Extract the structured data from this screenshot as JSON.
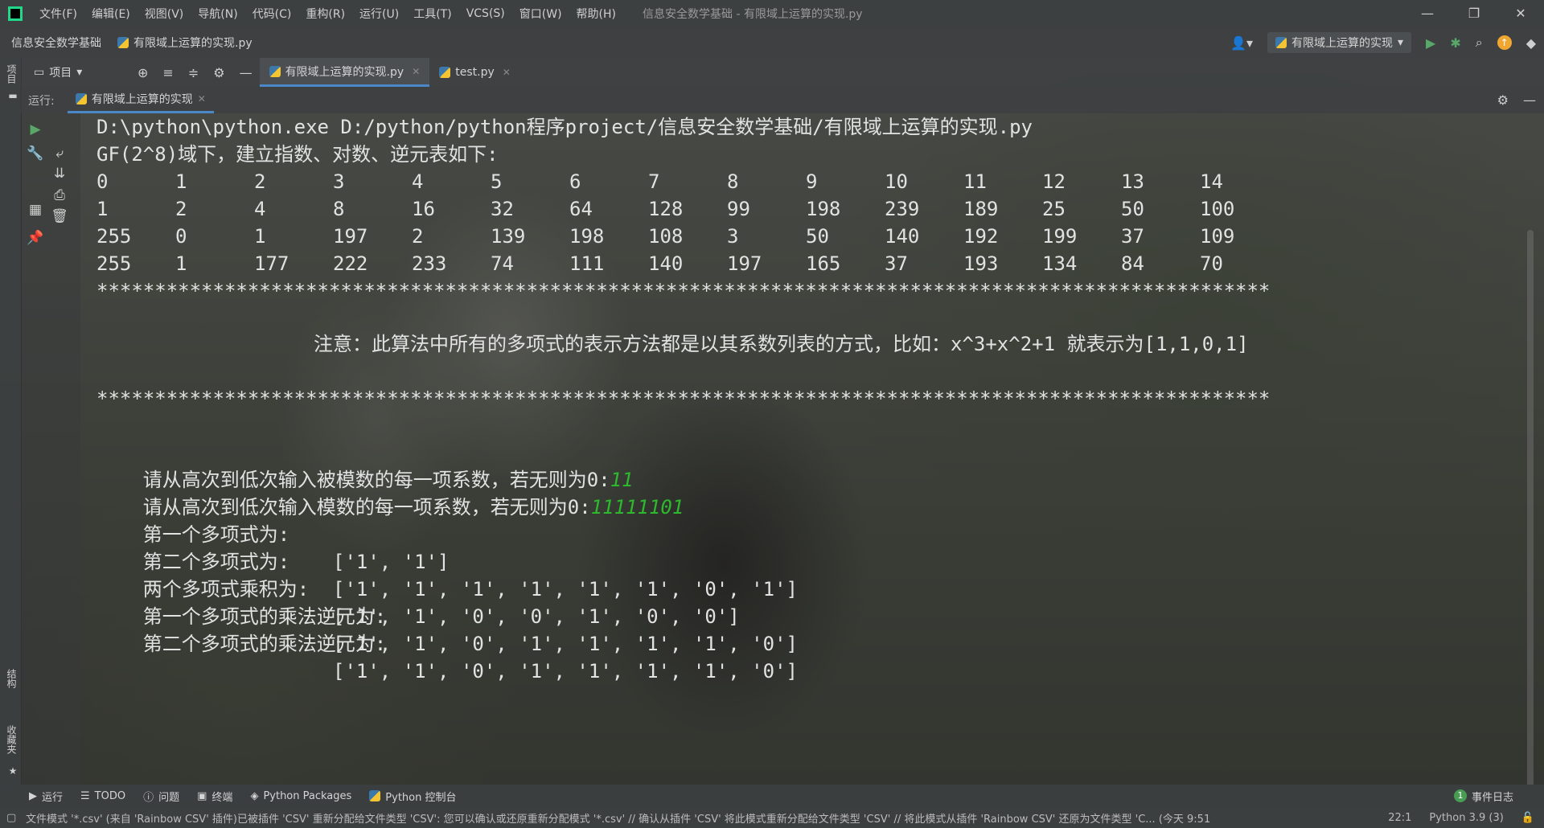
{
  "menubar": {
    "items": [
      "文件(F)",
      "编辑(E)",
      "视图(V)",
      "导航(N)",
      "代码(C)",
      "重构(R)",
      "运行(U)",
      "工具(T)",
      "VCS(S)",
      "窗口(W)",
      "帮助(H)"
    ],
    "window_title": "信息安全数学基础 - 有限域上运算的实现.py",
    "controls": [
      "—",
      "❐",
      "✕"
    ]
  },
  "navbar": {
    "project": "信息安全数学基础",
    "file": "有限域上运算的实现.py",
    "run_config": "有限域上运算的实现"
  },
  "tabbar": {
    "project_label": "项目",
    "tabs": [
      {
        "label": "有限域上运算的实现.py",
        "active": true
      },
      {
        "label": "test.py",
        "active": false
      }
    ]
  },
  "leftstrip": {
    "project_tab": "项目",
    "structure_tab": "结构",
    "favorites_tab": "收藏夹"
  },
  "runbar": {
    "label": "运行:",
    "tab": "有限域上运算的实现"
  },
  "console": {
    "command": "D:\\python\\python.exe D:/python/python程序project/信息安全数学基础/有限域上运算的实现.py",
    "heading": "GF(2^8)域下，建立指数、对数、逆元表如下:",
    "table": [
      [
        "0",
        "1",
        "2",
        "3",
        "4",
        "5",
        "6",
        "7",
        "8",
        "9",
        "10",
        "11",
        "12",
        "13",
        "14"
      ],
      [
        "1",
        "2",
        "4",
        "8",
        "16",
        "32",
        "64",
        "128",
        "99",
        "198",
        "239",
        "189",
        "25",
        "50",
        "100"
      ],
      [
        "255",
        "0",
        "1",
        "197",
        "2",
        "139",
        "198",
        "108",
        "3",
        "50",
        "140",
        "192",
        "199",
        "37",
        "109"
      ],
      [
        "255",
        "1",
        "177",
        "222",
        "233",
        "74",
        "111",
        "140",
        "197",
        "165",
        "37",
        "193",
        "134",
        "84",
        "70"
      ]
    ],
    "separator": "*****************************************************************************************************",
    "note": "注意：此算法中所有的多项式的表示方法都是以其系数列表的方式，比如：x^3+x^2+1 就表示为[1,1,0,1]",
    "prompt1": "请从高次到低次输入被模数的每一项系数，若无则为0:",
    "input1": "11",
    "prompt2": "请从高次到低次输入模数的每一项系数，若无则为0:",
    "input2": "11111101",
    "results": [
      {
        "label": "第一个多项式为:",
        "value": "['1', '1']"
      },
      {
        "label": "第二个多项式为:",
        "value": "['1', '1', '1', '1', '1', '1', '0', '1']"
      },
      {
        "label": "两个多项式乘积为:",
        "value": "['1', '1', '0', '0', '1', '0', '0']"
      },
      {
        "label": "第一个多项式的乘法逆元为:",
        "value": "['1', '1', '0', '1', '1', '1', '1', '0']"
      },
      {
        "label": "第二个多项式的乘法逆元为:",
        "value": "['1', '1', '0', '1', '1', '1', '1', '0']"
      }
    ]
  },
  "bottombar": {
    "tabs": [
      "运行",
      "TODO",
      "问题",
      "终端",
      "Python Packages",
      "Python 控制台"
    ],
    "event_log": "事件日志",
    "event_count": "1"
  },
  "statusbar": {
    "message": "文件模式 '*.csv' (来自 'Rainbow CSV' 插件)已被插件 'CSV' 重新分配给文件类型 'CSV': 您可以确认或还原重新分配模式 '*.csv' // 确认从插件 'CSV' 将此模式重新分配给文件类型 'CSV' // 将此模式从插件 'Rainbow CSV' 还原为文件类型 'C... (今天 9:51",
    "position": "22:1",
    "interpreter": "Python 3.9 (3)"
  }
}
